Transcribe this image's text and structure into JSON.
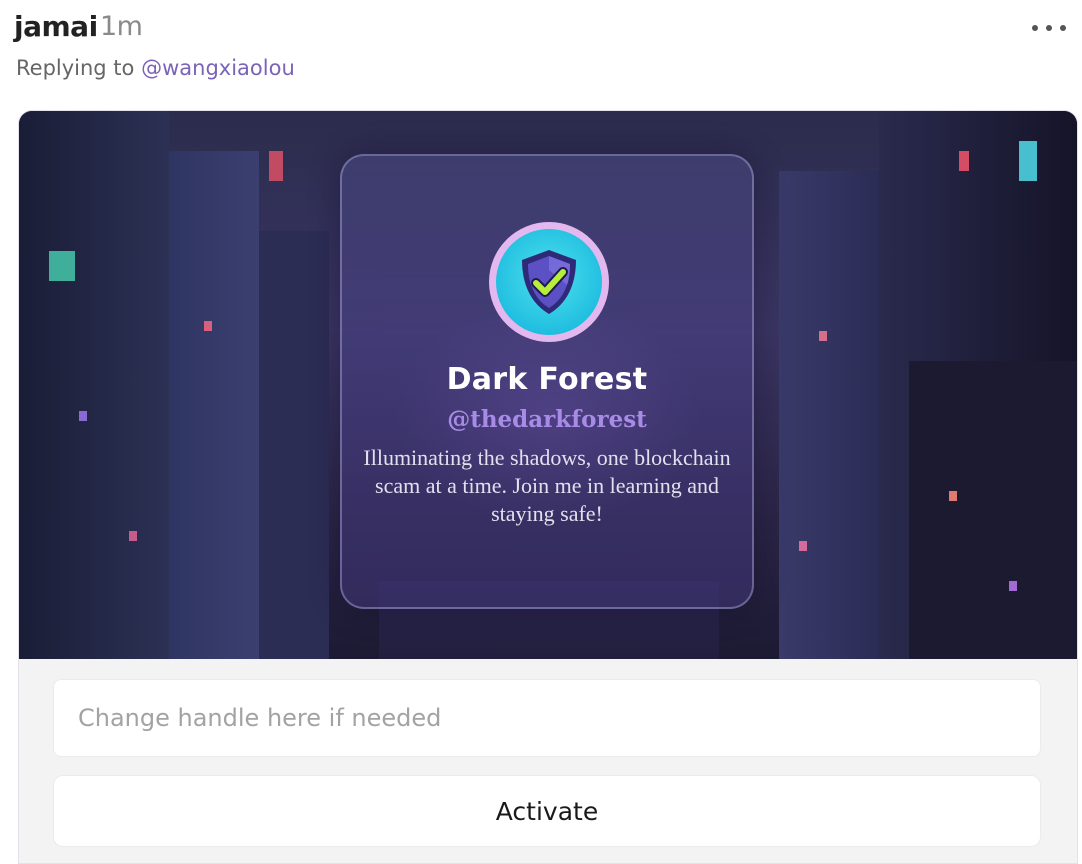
{
  "post": {
    "author": "jamai",
    "timestamp": "1m",
    "reply_prefix": "Replying to",
    "reply_mention": "@wangxiaolou"
  },
  "icons": {
    "more": "more-horizontal-icon",
    "avatar": "shield-check-icon"
  },
  "frame": {
    "profile_name": "Dark Forest",
    "profile_handle": "@thedarkforest",
    "profile_bio": "Illuminating the shadows, one blockchain scam at a time. Join me in learning and staying safe!",
    "input_placeholder": "Change handle here if needed",
    "input_value": "",
    "activate_label": "Activate"
  },
  "colors": {
    "mention": "#7a64b8",
    "handle_accent": "#a78be6",
    "avatar_bg": "#21bfe0",
    "shield": "#4a3fa8",
    "checkmark": "#b6ee3a"
  }
}
